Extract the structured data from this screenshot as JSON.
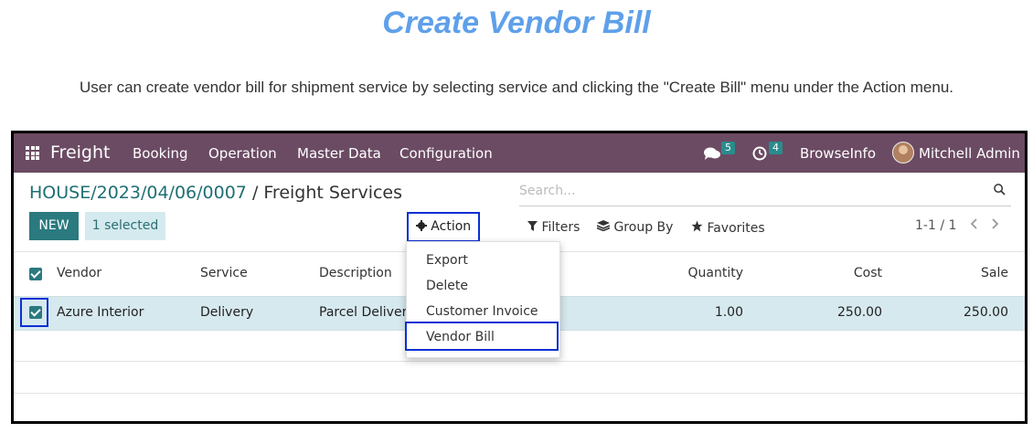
{
  "header": {
    "title": "Create Vendor Bill",
    "subtitle": "User can create vendor bill for shipment service by selecting service and clicking the \"Create Bill\" menu under the Action menu."
  },
  "navbar": {
    "app_name": "Freight",
    "menus": [
      "Booking",
      "Operation",
      "Master Data",
      "Configuration"
    ],
    "messages_count": "5",
    "activities_count": "4",
    "company": "BrowseInfo",
    "user": "Mitchell Admin"
  },
  "control_panel": {
    "breadcrumb_parent": "HOUSE/2023/04/06/0007",
    "breadcrumb_separator": "/",
    "breadcrumb_current": "Freight Services",
    "search_placeholder": "Search...",
    "new_label": "NEW",
    "selected_label": "1 selected",
    "action_label": "Action",
    "filters_label": "Filters",
    "groupby_label": "Group By",
    "favorites_label": "Favorites",
    "pager": "1-1 / 1"
  },
  "action_menu": {
    "items": [
      "Export",
      "Delete",
      "Customer Invoice",
      "Vendor Bill"
    ]
  },
  "table": {
    "columns": [
      "Vendor",
      "Service",
      "Description",
      "Quantity",
      "Cost",
      "Sale"
    ],
    "rows": [
      {
        "vendor": "Azure Interior",
        "service": "Delivery",
        "description": "Parcel Deliver",
        "quantity": "1.00",
        "cost": "250.00",
        "sale": "250.00",
        "selected": true
      }
    ]
  },
  "colors": {
    "navbar": "#6b4b63",
    "primary": "#2a7a7f",
    "highlight_box": "#0a2fd6",
    "title": "#5fa0ea",
    "selected_row": "#d6e9ee"
  }
}
